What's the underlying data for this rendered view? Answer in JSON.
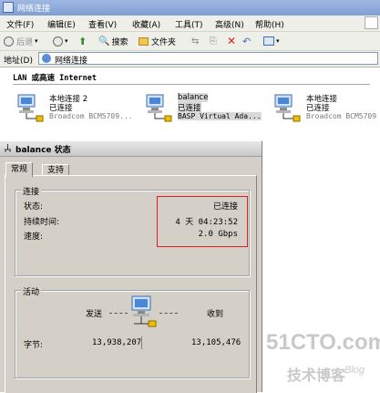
{
  "window": {
    "title": "网络连接"
  },
  "menu": [
    "文件(F)",
    "编辑(E)",
    "查看(V)",
    "收藏(A)",
    "工具(T)",
    "高级(N)",
    "帮助(H)"
  ],
  "toolbar": {
    "back": "后退",
    "search": "搜索",
    "folders": "文件夹"
  },
  "address": {
    "label": "地址(D)",
    "value": "网络连接"
  },
  "section": {
    "title": "LAN 或高速 Internet"
  },
  "connections": [
    {
      "name": "本地连接 2",
      "status": "已连接",
      "device": "Broadcom BCM5709..."
    },
    {
      "name": "balance",
      "status": "已连接",
      "device": "BASP Virtual Ada..."
    },
    {
      "name": "本地连接",
      "status": "已连接",
      "device": "Broadcom BCM5709"
    }
  ],
  "dialog": {
    "title": "balance 状态",
    "tabs": [
      "常规",
      "支持"
    ],
    "connection_group": "连接",
    "status_label": "状态:",
    "status_value": "已连接",
    "duration_label": "持续时间:",
    "duration_value": "4 天 04:23:52",
    "speed_label": "速度:",
    "speed_value": "2.0 Gbps",
    "activity_group": "活动",
    "sent_label": "发送",
    "received_label": "收到",
    "bytes_label": "字节:",
    "bytes_sent": "13,938,207",
    "bytes_received": "13,105,476"
  },
  "watermark": {
    "site": "51CTO.com",
    "sub": "技术博客",
    "blog": "Blog"
  },
  "colors": {
    "highlight_box": "#e02020",
    "title_bar": "#7f9fd2"
  }
}
